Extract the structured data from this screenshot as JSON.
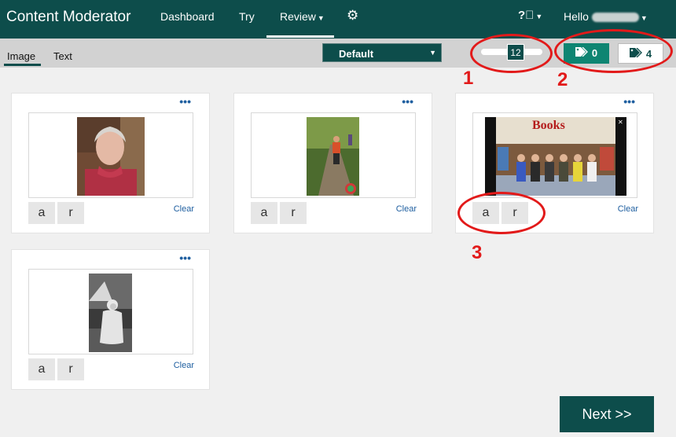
{
  "nav": {
    "brand": "Content Moderator",
    "dashboard": "Dashboard",
    "try": "Try",
    "review": "Review",
    "hello": "Hello"
  },
  "subbar": {
    "tab_image": "Image",
    "tab_text": "Text",
    "select_value": "Default",
    "slider_value": "12",
    "tag_active_count": "0",
    "tag_inactive_count": "4"
  },
  "annotations": [
    "1",
    "2",
    "3"
  ],
  "cards": [
    {
      "dots": "•••",
      "accept": "a",
      "reject": "r",
      "clear": "Clear"
    },
    {
      "dots": "•••",
      "accept": "a",
      "reject": "r",
      "clear": "Clear"
    },
    {
      "dots": "•••",
      "accept": "a",
      "reject": "r",
      "clear": "Clear",
      "photo_text": "Books"
    },
    {
      "dots": "•••",
      "accept": "a",
      "reject": "r",
      "clear": "Clear"
    }
  ],
  "next_label": "Next >>",
  "colors": {
    "primary": "#0d4d4b",
    "tag_active": "#0e8572",
    "annotation": "#e21a1a",
    "link": "#1f5fa0"
  }
}
